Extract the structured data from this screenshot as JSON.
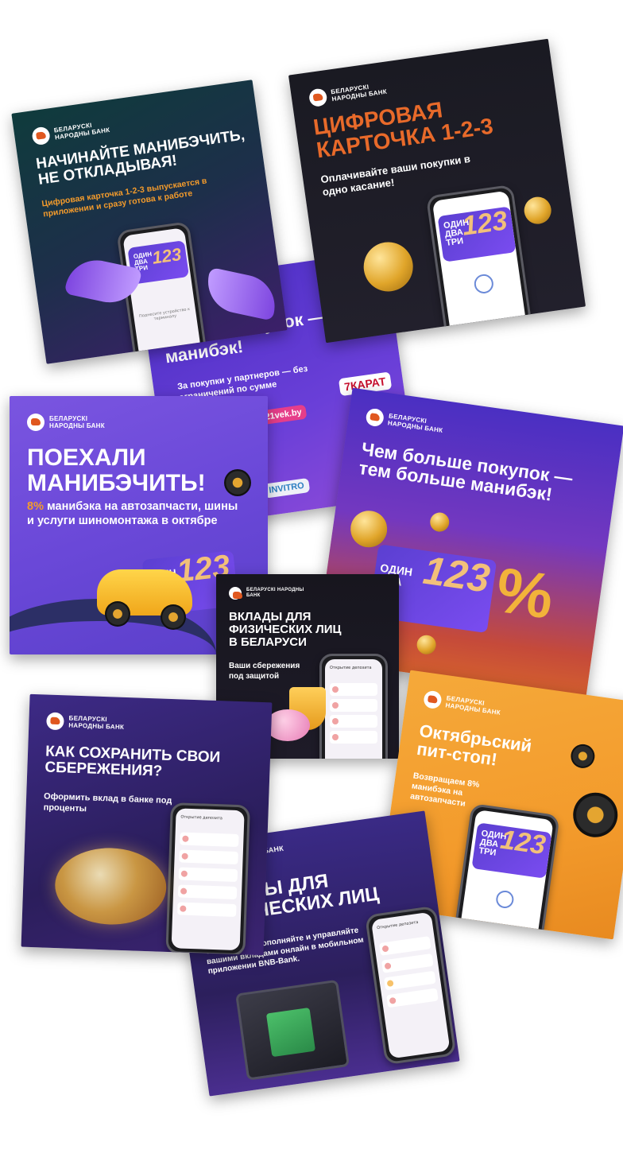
{
  "brand": {
    "name": "БЕЛАРУСКІ НАРОДНЫ БАНК",
    "accent_color": "#f39b2c",
    "logo_color": "#e0581f"
  },
  "banners": {
    "b1": {
      "title": "НАЧИНАЙТЕ МАНИБЭЧИТЬ, НЕ ОТКЛАДЫВАЯ!",
      "subtitle": "Цифровая карточка 1-2-3 выпускается в приложении и сразу готова к работе",
      "phone_hint": "Поднесите устройство к терминалу"
    },
    "b2": {
      "title": "ЦИФРОВАЯ КАРТОЧКА 1-2-3",
      "subtitle": "Оплачивайте ваши покупки в одно касание!"
    },
    "b3": {
      "title_fragment": "больше покупок — манибэк!",
      "subtitle": "За покупки у партнеров — без ограничений по сумме",
      "partners": [
        "21vek.by",
        "7КАРАТ",
        "INVITRO"
      ]
    },
    "b4": {
      "title": "ПОЕХАЛИ МАНИБЭЧИТЬ!",
      "subtitle_accent": "8%",
      "subtitle": "манибэка на автозапчасти, шины и услуги шиномонтажа в октябре"
    },
    "b5": {
      "title": "Чем больше покупок — тем больше манибэк!"
    },
    "b6": {
      "title": "ВКЛАДЫ ДЛЯ ФИЗИЧЕСКИХ ЛИЦ В БЕЛАРУСИ",
      "subtitle": "Ваши сбережения под защитой",
      "phone_header": "Открытие депозита"
    },
    "b7": {
      "title": "КАК СОХРАНИТЬ СВОИ СБЕРЕЖЕНИЯ?",
      "subtitle": "Оформить вклад в банке под проценты",
      "phone_header": "Открытие депозита"
    },
    "b8": {
      "title": "Октябрьский пит-стоп!",
      "subtitle": "Возвращаем 8% манибэка на автозапчасти"
    },
    "b9": {
      "logo_fragment": "БАНК",
      "title_fragment": "ВКЛАДЫ ДЛЯ ФИЗИЧЕСКИХ ЛИЦ",
      "subtitle": "Открывайте, пополняйте и управляйте вашими вкладами онлайн в мобильном приложении BNB-Bank.",
      "phone_header": "Открытие депозита"
    }
  },
  "card": {
    "words": "ОДИН ДВА ТРИ",
    "digits": "123",
    "percent": "%"
  }
}
